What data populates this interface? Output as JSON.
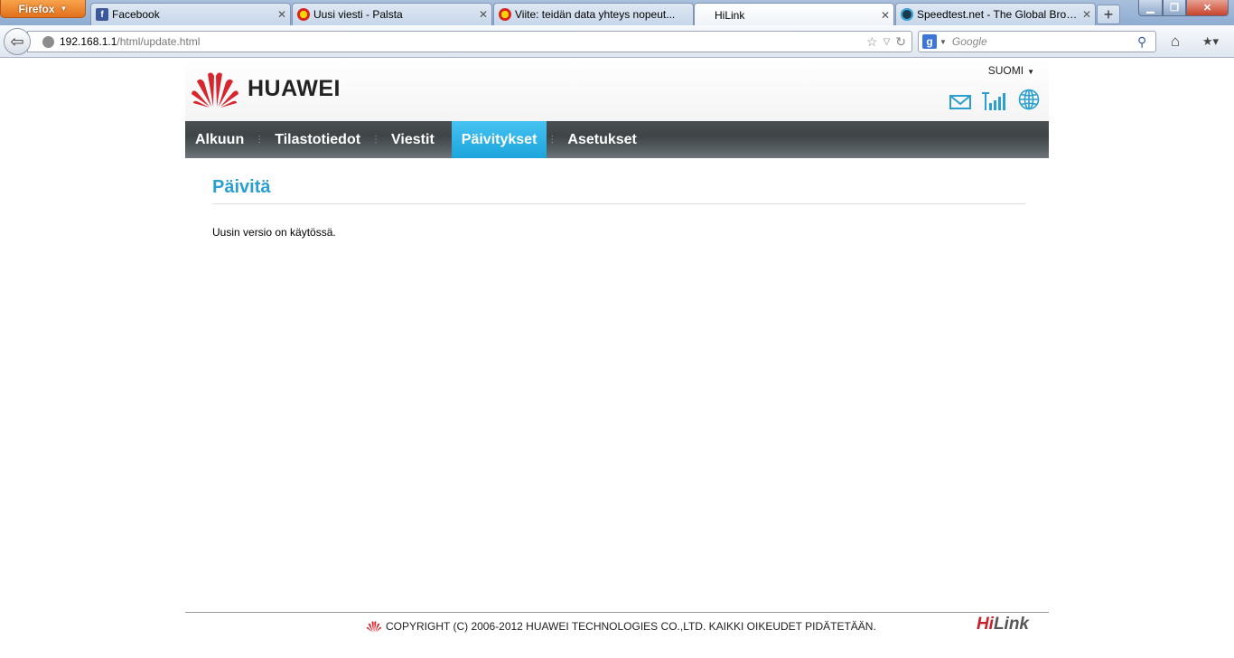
{
  "browser": {
    "app_button": "Firefox",
    "tabs": [
      {
        "label": "Facebook",
        "favicon": "f"
      },
      {
        "label": "Uusi viesti - Palsta",
        "favicon": ""
      },
      {
        "label": "Viite: teidän data yhteys nopeut...",
        "favicon": ""
      },
      {
        "label": "HiLink",
        "favicon": ""
      },
      {
        "label": "Speedtest.net - The Global Broa...",
        "favicon": ""
      }
    ],
    "url_host": "192.168.1.1",
    "url_path": "/html/update.html",
    "search_engine_letter": "g",
    "search_placeholder": "Google"
  },
  "header": {
    "brand": "HUAWEI",
    "language": "SUOMI"
  },
  "nav": {
    "items": [
      "Alkuun",
      "Tilastotiedot",
      "Viestit",
      "Päivitykset",
      "Asetukset"
    ],
    "active_index": 3
  },
  "main": {
    "title": "Päivitä",
    "message": "Uusin versio on käytössä."
  },
  "footer": {
    "copyright": "COPYRIGHT (C) 2006-2012 HUAWEI TECHNOLOGIES CO.,LTD. KAIKKI OIKEUDET PIDÄTETÄÄN.",
    "hilink_h": "Hi",
    "hilink_rest": "Link"
  },
  "colors": {
    "accent": "#1ba5dc",
    "title": "#2a9fd0",
    "brand_red": "#c8202a",
    "nav_bg": "#4a4f52"
  },
  "icons": [
    "mail-icon",
    "signal-icon",
    "globe-icon",
    "huawei-logo"
  ]
}
